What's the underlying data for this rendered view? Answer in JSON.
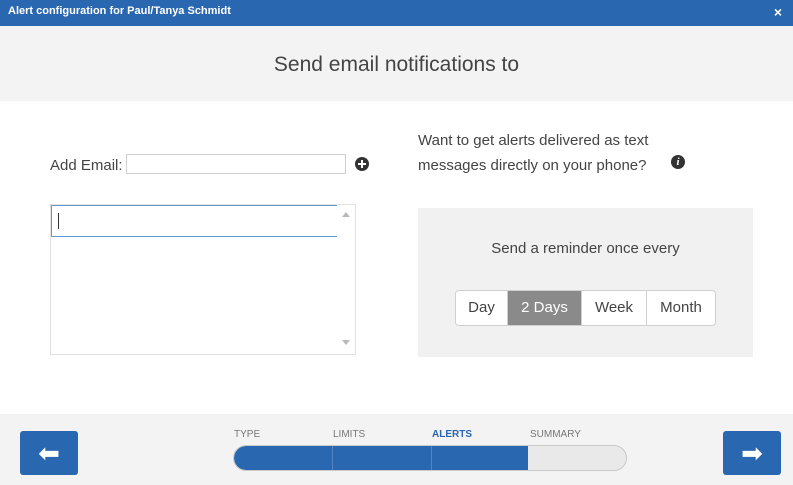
{
  "window": {
    "title": "Alert configuration for Paul/Tanya Schmidt",
    "close_glyph": "×"
  },
  "banner": {
    "heading": "Send email notifications to"
  },
  "email": {
    "label": "Add Email:",
    "input_value": "",
    "add_icon": "plus-circle-icon",
    "list_entry_value": ""
  },
  "sms": {
    "text": "Want to get alerts delivered as text messages directly on your phone?",
    "info_icon": "info-icon",
    "info_glyph": "i"
  },
  "reminder": {
    "label": "Send a reminder once every",
    "options": [
      "Day",
      "2 Days",
      "Week",
      "Month"
    ],
    "selected": "2 Days"
  },
  "wizard": {
    "steps": [
      "TYPE",
      "LIMITS",
      "ALERTS",
      "SUMMARY"
    ],
    "current_step": "ALERTS",
    "progress_fraction": 0.75,
    "prev_glyph": "⬅",
    "next_glyph": "➡"
  },
  "colors": {
    "accent": "#2a67b1",
    "selected_option": "#8a8a8a",
    "panel_bg": "#f1f1f1"
  }
}
